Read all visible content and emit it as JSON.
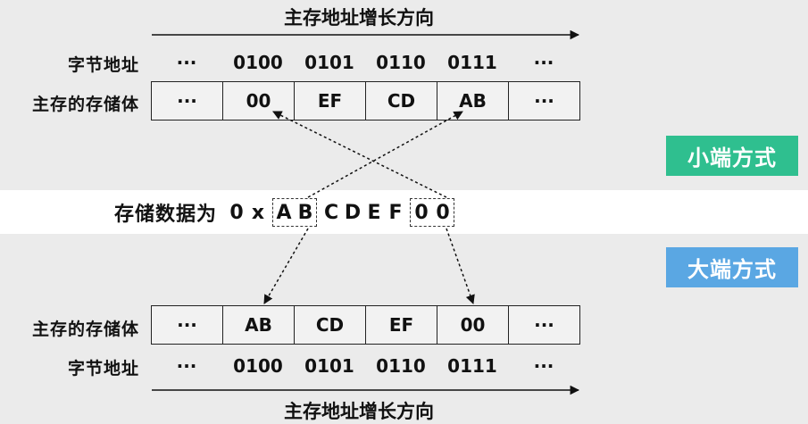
{
  "top": {
    "direction_label": "主存地址增长方向",
    "byte_address_label": "字节地址",
    "storage_label": "主存的存储体",
    "addresses": [
      "···",
      "0100",
      "0101",
      "0110",
      "0111",
      "···"
    ],
    "cells": [
      "···",
      "00",
      "EF",
      "CD",
      "AB",
      "···"
    ]
  },
  "little_endian_badge": "小端方式",
  "big_endian_badge": "大端方式",
  "data": {
    "prefix": "存储数据为",
    "chars": [
      "0",
      "x",
      "A",
      "B",
      "C",
      "D",
      "E",
      "F",
      "0",
      "0"
    ]
  },
  "bottom": {
    "storage_label": "主存的存储体",
    "byte_address_label": "字节地址",
    "direction_label": "主存地址增长方向",
    "addresses": [
      "···",
      "0100",
      "0101",
      "0110",
      "0111",
      "···"
    ],
    "cells": [
      "···",
      "AB",
      "CD",
      "EF",
      "00",
      "···"
    ]
  },
  "colors": {
    "little_badge": "#2fbf8f",
    "big_badge": "#5aa7e3",
    "band": "#ffffff",
    "background": "#ebebeb"
  }
}
